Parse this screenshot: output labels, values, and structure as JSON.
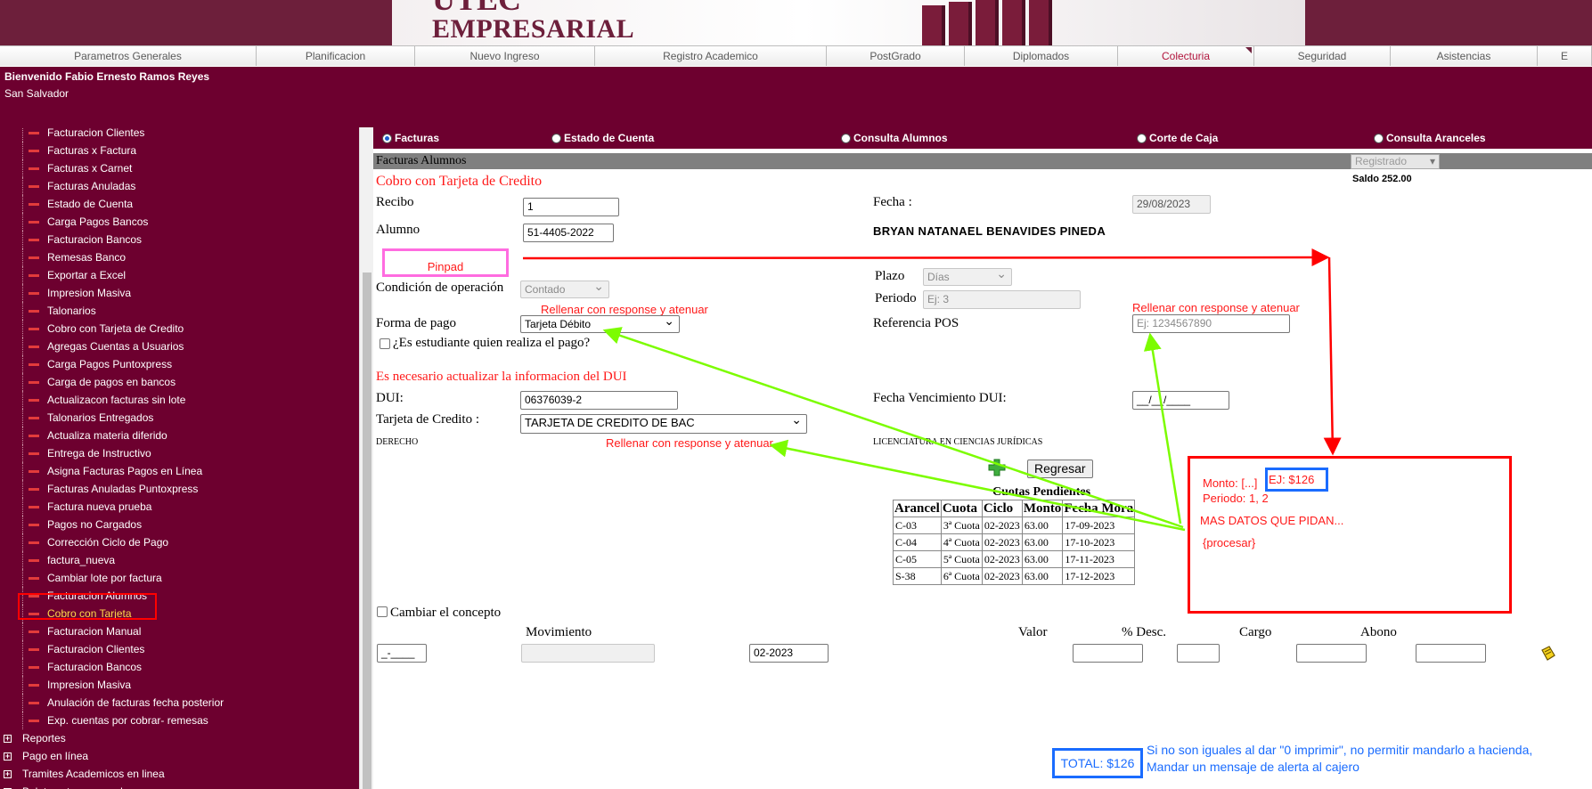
{
  "banner": {
    "logo_top": "UTEC",
    "logo_bottom": "EMPRESARIAL"
  },
  "nav": {
    "tabs": [
      "Parametros Generales",
      "Planificacion",
      "Nuevo Ingreso",
      "Registro Academico",
      "PostGrado",
      "Diplomados",
      "Colecturia",
      "Seguridad",
      "Asistencias",
      "E"
    ],
    "active": "Colecturia"
  },
  "welcome": {
    "name": "Bienvenido Fabio Ernesto Ramos Reyes",
    "city": "San Salvador"
  },
  "sidebar": {
    "items": [
      "Facturacion Clientes",
      "Facturas x Factura",
      "Facturas x Carnet",
      "Facturas Anuladas",
      "Estado de Cuenta",
      "Carga Pagos Bancos",
      "Facturacion Bancos",
      "Remesas Banco",
      "Exportar a Excel",
      "Impresion Masiva",
      "Talonarios",
      "Cobro con Tarjeta de Credito",
      "Agregas Cuentas a Usuarios",
      "Carga Pagos Puntoxpress",
      "Carga de pagos en bancos",
      "Actualizacon facturas sin lote",
      "Talonarios Entregados",
      "Actualiza materia diferido",
      "Entrega de Instructivo",
      "Asigna Facturas Pagos en Línea",
      "Facturas Anuladas Puntoxpress",
      "Factura nueva prueba",
      "Pagos no Cargados",
      "Corrección Ciclo de Pago",
      "factura_nueva",
      "Cambiar lote por factura",
      "Facturacion Alumnos",
      "Cobro con Tarjeta",
      "Facturacion Manual",
      "Facturacion Clientes",
      "Facturacion Bancos",
      "Impresion Masiva",
      "Anulación de facturas fecha posterior",
      "Exp. cuentas por cobrar- remesas"
    ],
    "active_item": "Cobro con Tarjeta",
    "roots": [
      "Reportes",
      "Pago en línea",
      "Tramites Academicos en linea",
      "Boletas otros aranceles"
    ]
  },
  "radios": {
    "facturas": "Facturas",
    "estado": "Estado de Cuenta",
    "consulta_alumnos": "Consulta Alumnos",
    "corte": "Corte de Caja",
    "aranceles": "Consulta Aranceles"
  },
  "form": {
    "section_title": "Facturas Alumnos",
    "status": "Registrado",
    "saldo": "Saldo 252.00",
    "heading": "Cobro con Tarjeta de Credito",
    "recibo_label": "Recibo",
    "recibo_value": "1",
    "fecha_label": "Fecha :",
    "fecha_value": "29/08/2023",
    "alumno_label": "Alumno",
    "alumno_value": "51-4405-2022",
    "student_name": "BRYAN NATANAEL BENAVIDES PINEDA",
    "pinpad_label": "Pinpad",
    "plazo_label": "Plazo",
    "plazo_value": "Días",
    "condicion_label": "Condición de operación",
    "condicion_value": "Contado",
    "periodo_label": "Periodo",
    "periodo_placeholder": "Ej: 3",
    "forma_pago_label": "Forma de pago",
    "forma_pago_value": "Tarjeta Débito",
    "referencia_label": "Referencia POS",
    "referencia_placeholder": "Ej: 1234567890",
    "estudiante_check": "¿Es estudiante quien realiza el pago?",
    "dui_warning": "Es necesario actualizar la informacion del DUI",
    "dui_label": "DUI:",
    "dui_value": "06376039-2",
    "venc_label": "Fecha Vencimiento DUI:",
    "venc_value": "__/__/____",
    "tarjeta_label": "Tarjeta de Credito :",
    "tarjeta_value": "TARJETA DE CREDITO DE BAC",
    "faculty": "DERECHO",
    "career": "LICENCIATURA EN CIENCIAS JURÍDICAS",
    "regresar": "Regresar",
    "cambiar_concepto": "Cambiar el concepto",
    "movimiento_label": "Movimiento",
    "valor_label": "Valor",
    "desc_label": "% Desc.",
    "cargo_label": "Cargo",
    "abono_label": "Abono",
    "concepto_code": "_-____",
    "ciclo_value": "02-2023"
  },
  "cuotas": {
    "title": "Cuotas Pendientes",
    "headers": [
      "Arancel",
      "Cuota",
      "Ciclo",
      "Monto",
      "Fecha Mora"
    ],
    "rows": [
      [
        "C-03",
        "3ª Cuota",
        "02-2023",
        "63.00",
        "17-09-2023"
      ],
      [
        "C-04",
        "4ª Cuota",
        "02-2023",
        "63.00",
        "17-10-2023"
      ],
      [
        "C-05",
        "5ª Cuota",
        "02-2023",
        "63.00",
        "17-11-2023"
      ],
      [
        "S-38",
        "6ª Cuota",
        "02-2023",
        "63.00",
        "17-12-2023"
      ]
    ]
  },
  "annotations": {
    "rellenar": "Rellenar con response y atenuar",
    "monto": "Monto: [...]",
    "ej": "EJ: $126",
    "periodo": "Periodo: 1, 2",
    "mas_datos": "MAS DATOS QUE PIDAN...",
    "procesar": "{procesar}",
    "total": "TOTAL: $126",
    "note_line1": "Si no son iguales al dar \"0 imprimir\", no permitir mandarlo a hacienda,",
    "note_line2": "Mandar un mensaje de alerta al cajero"
  },
  "colors": {
    "brand": "#6d002f",
    "annotation_red": "#ff0000",
    "annotation_green": "#7cfc00",
    "annotation_blue": "#1a6cff",
    "pinpad_pink": "#ff6ce0"
  }
}
